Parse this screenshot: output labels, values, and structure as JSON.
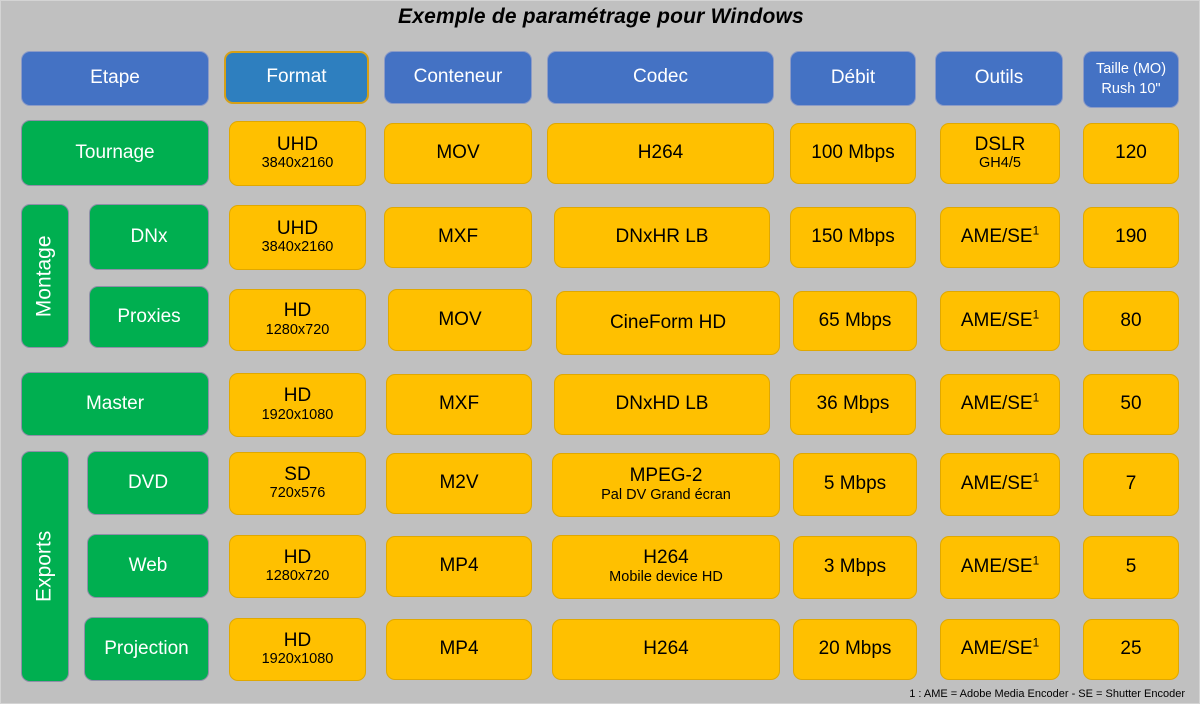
{
  "title": "Exemple de paramétrage pour Windows",
  "footnote": "1 : AME = Adobe Media Encoder - SE = Shutter Encoder",
  "colors": {
    "background": "#C0C0C0",
    "header_blue": "#4472C4",
    "header_accent_blue": "#2E7FBF",
    "header_accent_border": "#D6A017",
    "stage_green": "#00AF50",
    "data_yellow": "#FFC000",
    "text_light": "#FFFFFF",
    "text_dark": "#000000"
  },
  "headers": [
    {
      "label": "Etape",
      "accent": false
    },
    {
      "label": "Format",
      "accent": true
    },
    {
      "label": "Conteneur",
      "accent": false
    },
    {
      "label": "Codec",
      "accent": false
    },
    {
      "label": "Débit",
      "accent": false
    },
    {
      "label": "Outils",
      "accent": false
    },
    {
      "label": "Taille (MO)",
      "label2": "Rush 10\"",
      "accent": false
    }
  ],
  "groups": [
    {
      "label": "Montage"
    },
    {
      "label": "Exports"
    }
  ],
  "rows": [
    {
      "stage": "Tournage",
      "format": "UHD",
      "format_sub": "3840x2160",
      "conteneur": "MOV",
      "codec": "H264",
      "codec_sub": "",
      "debit": "100 Mbps",
      "outils": "DSLR",
      "outils_sub": "GH4/5",
      "outils_sup": "",
      "taille": "120"
    },
    {
      "stage": "DNx",
      "format": "UHD",
      "format_sub": "3840x2160",
      "conteneur": "MXF",
      "codec": "DNxHR LB",
      "codec_sub": "",
      "debit": "150 Mbps",
      "outils": "AME/SE",
      "outils_sub": "",
      "outils_sup": "1",
      "taille": "190"
    },
    {
      "stage": "Proxies",
      "format": "HD",
      "format_sub": "1280x720",
      "conteneur": "MOV",
      "codec": "CineForm HD",
      "codec_sub": "",
      "debit": "65 Mbps",
      "outils": "AME/SE",
      "outils_sub": "",
      "outils_sup": "1",
      "taille": "80"
    },
    {
      "stage": "Master",
      "format": "HD",
      "format_sub": "1920x1080",
      "conteneur": "MXF",
      "codec": "DNxHD LB",
      "codec_sub": "",
      "debit": "36 Mbps",
      "outils": "AME/SE",
      "outils_sub": "",
      "outils_sup": "1",
      "taille": "50"
    },
    {
      "stage": "DVD",
      "format": "SD",
      "format_sub": "720x576",
      "conteneur": "M2V",
      "codec": "MPEG-2",
      "codec_sub": "Pal DV Grand écran",
      "debit": "5 Mbps",
      "outils": "AME/SE",
      "outils_sub": "",
      "outils_sup": "1",
      "taille": "7"
    },
    {
      "stage": "Web",
      "format": "HD",
      "format_sub": "1280x720",
      "conteneur": "MP4",
      "codec": "H264",
      "codec_sub": "Mobile device HD",
      "debit": "3 Mbps",
      "outils": "AME/SE",
      "outils_sub": "",
      "outils_sup": "1",
      "taille": "5"
    },
    {
      "stage": "Projection",
      "format": "HD",
      "format_sub": "1920x1080",
      "conteneur": "MP4",
      "codec": "H264",
      "codec_sub": "",
      "debit": "20 Mbps",
      "outils": "AME/SE",
      "outils_sub": "",
      "outils_sup": "1",
      "taille": "25"
    }
  ]
}
